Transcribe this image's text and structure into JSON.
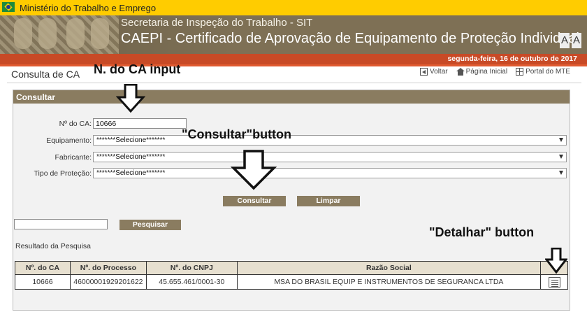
{
  "gov_bar": {
    "title": "Ministério do Trabalho e Emprego"
  },
  "banner": {
    "subtitle": "Secretaria de Inspeção do Trabalho - SIT",
    "title": "CAEPI - Certificado de Aprovação de Equipamento de Proteção Individual",
    "font_button": "A"
  },
  "date": "segunda-feira, 16 de outubro de 2017",
  "page": {
    "title": "Consulta de CA",
    "links": [
      {
        "label": "Voltar",
        "icon": "back-icon"
      },
      {
        "label": "Página Inicial",
        "icon": "home-icon"
      },
      {
        "label": "Portal do MTE",
        "icon": "portal-icon"
      }
    ]
  },
  "form": {
    "header": "Consultar",
    "ca_label": "Nº do CA:",
    "ca_value": "10666",
    "equipamento_label": "Equipamento:",
    "equipamento_value": "*******Selecione*******",
    "fabricante_label": "Fabricante:",
    "fabricante_value": "*******Selecione*******",
    "tipo_label": "Tipo de Proteção:",
    "tipo_value": "*******Selecione*******",
    "consultar_label": "Consultar",
    "limpar_label": "Limpar",
    "search_value": "",
    "pesquisar_label": "Pesquisar"
  },
  "results": {
    "label": "Resultado da Pesquisa",
    "columns": [
      "Nº. do CA",
      "Nº. do Processo",
      "Nº. do CNPJ",
      "Razão Social",
      ""
    ],
    "rows": [
      {
        "ca": "10666",
        "processo": "46000001929201622",
        "cnpj": "45.655.461/0001-30",
        "razao": "MSA DO BRASIL EQUIP E INSTRUMENTOS DE SEGURANCA LTDA",
        "action_icon": "detail-icon"
      }
    ]
  },
  "annotations": {
    "ca_input": "N. do CA input",
    "consultar_button": "\"Consultar\"button",
    "detalhar_button": "\"Detalhar\" button"
  }
}
